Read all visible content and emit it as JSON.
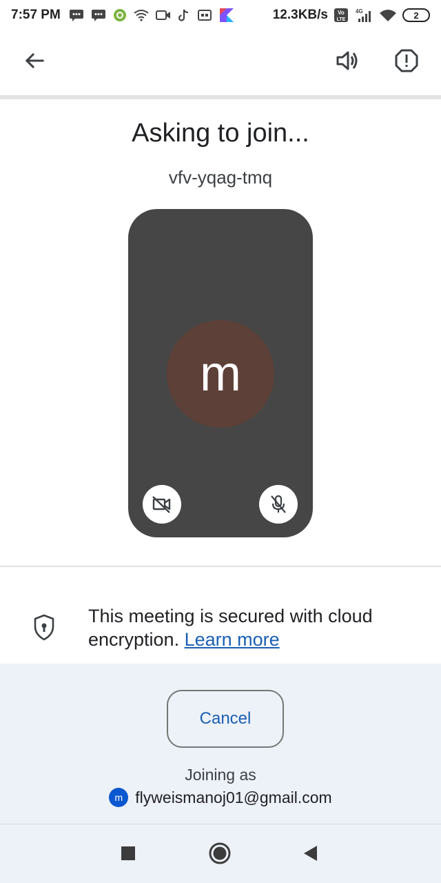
{
  "status_bar": {
    "time": "7:57 PM",
    "speed": "12.3KB/s",
    "network_type": "4G",
    "volte": "Vo LTE",
    "battery": "2",
    "icons": [
      "message-icon",
      "message-icon",
      "gear-app-icon",
      "wifi-icon",
      "video-icon",
      "tiktok-icon",
      "vr-icon",
      "kotlin-icon",
      "signal-icon",
      "wifi-icon",
      "battery-icon"
    ]
  },
  "app_bar": {
    "icons": [
      "back-arrow-icon",
      "speaker-icon",
      "report-icon"
    ]
  },
  "main": {
    "title": "Asking to join...",
    "meeting_code": "vfv-yqag-tmq",
    "avatar_letter": "m",
    "avatar_color": "#5d4037",
    "preview_bg": "#464646",
    "controls": [
      "camera-off-icon",
      "mic-off-icon"
    ]
  },
  "security": {
    "text": "This meeting is secured with cloud encryption.",
    "link": "Learn more"
  },
  "bottom": {
    "cancel_label": "Cancel",
    "joining_as_label": "Joining as",
    "account_initial": "m",
    "email": "flyweismanoj01@gmail.com"
  },
  "colors": {
    "accent": "#1a5fb4",
    "bottom_bg": "#edf1f8"
  }
}
